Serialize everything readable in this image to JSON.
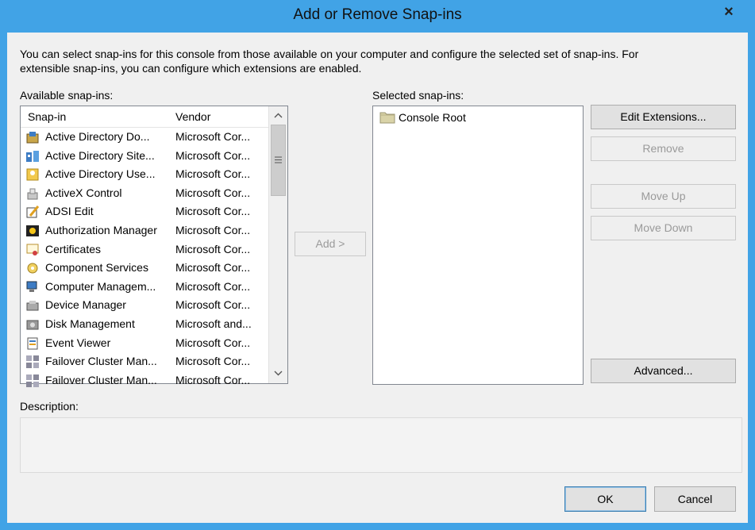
{
  "window": {
    "title": "Add or Remove Snap-ins",
    "close_glyph": "×"
  },
  "intro_text_line1": "You can select snap-ins for this console from those available on your computer and configure the selected set of snap-ins. For",
  "intro_text_line2": "extensible snap-ins, you can configure which extensions are enabled.",
  "available": {
    "label": "Available snap-ins:",
    "columns": {
      "name": "Snap-in",
      "vendor": "Vendor"
    },
    "items": [
      {
        "name": "Active Directory Do...",
        "vendor": "Microsoft Cor...",
        "icon": "ad-domains-icon"
      },
      {
        "name": "Active Directory Site...",
        "vendor": "Microsoft Cor...",
        "icon": "ad-sites-icon"
      },
      {
        "name": "Active Directory Use...",
        "vendor": "Microsoft Cor...",
        "icon": "ad-users-icon"
      },
      {
        "name": "ActiveX Control",
        "vendor": "Microsoft Cor...",
        "icon": "activex-icon"
      },
      {
        "name": "ADSI Edit",
        "vendor": "Microsoft Cor...",
        "icon": "adsi-edit-icon"
      },
      {
        "name": "Authorization Manager",
        "vendor": "Microsoft Cor...",
        "icon": "authorization-icon"
      },
      {
        "name": "Certificates",
        "vendor": "Microsoft Cor...",
        "icon": "certificates-icon"
      },
      {
        "name": "Component Services",
        "vendor": "Microsoft Cor...",
        "icon": "component-services-icon"
      },
      {
        "name": "Computer Managem...",
        "vendor": "Microsoft Cor...",
        "icon": "computer-management-icon"
      },
      {
        "name": "Device Manager",
        "vendor": "Microsoft Cor...",
        "icon": "device-manager-icon"
      },
      {
        "name": "Disk Management",
        "vendor": "Microsoft and...",
        "icon": "disk-management-icon"
      },
      {
        "name": "Event Viewer",
        "vendor": "Microsoft Cor...",
        "icon": "event-viewer-icon"
      },
      {
        "name": "Failover Cluster Man...",
        "vendor": "Microsoft Cor...",
        "icon": "failover-cluster-icon"
      },
      {
        "name": "Failover Cluster Man...",
        "vendor": "Microsoft Cor...",
        "icon": "failover-cluster-icon"
      }
    ],
    "scroll_up": "⌃",
    "scroll_down": "⌄"
  },
  "add_button": "Add >",
  "selected": {
    "label": "Selected snap-ins:",
    "items": [
      {
        "name": "Console Root",
        "icon": "folder-icon"
      }
    ]
  },
  "buttons": {
    "edit_extensions": "Edit Extensions...",
    "remove": "Remove",
    "move_up": "Move Up",
    "move_down": "Move Down",
    "advanced": "Advanced..."
  },
  "description": {
    "label": "Description:"
  },
  "footer": {
    "ok": "OK",
    "cancel": "Cancel"
  },
  "colors": {
    "title_bar": "#41a3e6",
    "dialog_bg": "#f0f0f0",
    "button_bg": "#e1e1e1"
  }
}
